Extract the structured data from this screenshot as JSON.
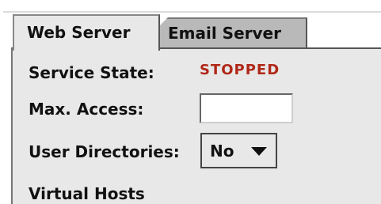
{
  "tabs": [
    {
      "label": "Web Server",
      "active": true
    },
    {
      "label": "Email Server",
      "active": false
    }
  ],
  "form": {
    "service_state_label": "Service State:",
    "service_state_value": "STOPPED",
    "max_access_label": "Max. Access:",
    "max_access_value": "",
    "user_directories_label": "User Directories:",
    "user_directories_value": "No",
    "virtual_hosts_label": "Virtual Hosts"
  },
  "icons": {
    "dropdown": "chevron-down-icon"
  },
  "colors": {
    "panel_background": "#e8e8e8",
    "inactive_tab": "#b9b9b9",
    "stopped_status": "#b02818"
  }
}
